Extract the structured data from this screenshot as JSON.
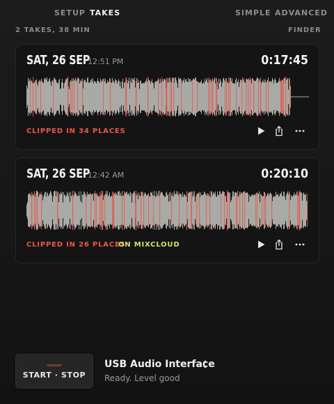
{
  "nav": {
    "setup": "SETUP",
    "takes": "TAKES",
    "simple": "SIMPLE",
    "advanced": "ADVANCED"
  },
  "summary": "2 TAKES, 38 MIN",
  "finder": "FINDER",
  "takes": [
    {
      "date": "SAT, 26 SEP",
      "time": "12:51 PM",
      "duration": "0:17:45",
      "clipped": "CLIPPED IN 34 PLACES",
      "mixcloud": ""
    },
    {
      "date": "SAT, 26 SEP",
      "time": "12:42 AM",
      "duration": "0:20:10",
      "clipped": "CLIPPED IN 26 PLACES",
      "mixcloud": "ON MIXCLOUD"
    }
  ],
  "recorder": {
    "button": "START · STOP",
    "device": "USB Audio Interface",
    "status": "Ready. Level good"
  },
  "colors": {
    "waveform": "#a9aaa6",
    "clip": "#e7574b",
    "mixcloud": "#c8e86b",
    "background": "#171717"
  },
  "icons": [
    "play-icon",
    "share-icon",
    "more-icon",
    "chevron-updown-icon"
  ]
}
